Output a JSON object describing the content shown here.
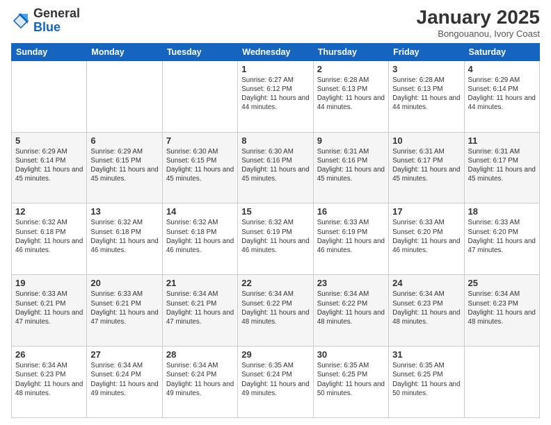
{
  "header": {
    "logo_general": "General",
    "logo_blue": "Blue",
    "month_year": "January 2025",
    "location": "Bongouanou, Ivory Coast"
  },
  "days_of_week": [
    "Sunday",
    "Monday",
    "Tuesday",
    "Wednesday",
    "Thursday",
    "Friday",
    "Saturday"
  ],
  "weeks": [
    [
      {
        "day": "",
        "info": ""
      },
      {
        "day": "",
        "info": ""
      },
      {
        "day": "",
        "info": ""
      },
      {
        "day": "1",
        "info": "Sunrise: 6:27 AM\nSunset: 6:12 PM\nDaylight: 11 hours\nand 44 minutes."
      },
      {
        "day": "2",
        "info": "Sunrise: 6:28 AM\nSunset: 6:13 PM\nDaylight: 11 hours\nand 44 minutes."
      },
      {
        "day": "3",
        "info": "Sunrise: 6:28 AM\nSunset: 6:13 PM\nDaylight: 11 hours\nand 44 minutes."
      },
      {
        "day": "4",
        "info": "Sunrise: 6:29 AM\nSunset: 6:14 PM\nDaylight: 11 hours\nand 44 minutes."
      }
    ],
    [
      {
        "day": "5",
        "info": "Sunrise: 6:29 AM\nSunset: 6:14 PM\nDaylight: 11 hours\nand 45 minutes."
      },
      {
        "day": "6",
        "info": "Sunrise: 6:29 AM\nSunset: 6:15 PM\nDaylight: 11 hours\nand 45 minutes."
      },
      {
        "day": "7",
        "info": "Sunrise: 6:30 AM\nSunset: 6:15 PM\nDaylight: 11 hours\nand 45 minutes."
      },
      {
        "day": "8",
        "info": "Sunrise: 6:30 AM\nSunset: 6:16 PM\nDaylight: 11 hours\nand 45 minutes."
      },
      {
        "day": "9",
        "info": "Sunrise: 6:31 AM\nSunset: 6:16 PM\nDaylight: 11 hours\nand 45 minutes."
      },
      {
        "day": "10",
        "info": "Sunrise: 6:31 AM\nSunset: 6:17 PM\nDaylight: 11 hours\nand 45 minutes."
      },
      {
        "day": "11",
        "info": "Sunrise: 6:31 AM\nSunset: 6:17 PM\nDaylight: 11 hours\nand 45 minutes."
      }
    ],
    [
      {
        "day": "12",
        "info": "Sunrise: 6:32 AM\nSunset: 6:18 PM\nDaylight: 11 hours\nand 46 minutes."
      },
      {
        "day": "13",
        "info": "Sunrise: 6:32 AM\nSunset: 6:18 PM\nDaylight: 11 hours\nand 46 minutes."
      },
      {
        "day": "14",
        "info": "Sunrise: 6:32 AM\nSunset: 6:18 PM\nDaylight: 11 hours\nand 46 minutes."
      },
      {
        "day": "15",
        "info": "Sunrise: 6:32 AM\nSunset: 6:19 PM\nDaylight: 11 hours\nand 46 minutes."
      },
      {
        "day": "16",
        "info": "Sunrise: 6:33 AM\nSunset: 6:19 PM\nDaylight: 11 hours\nand 46 minutes."
      },
      {
        "day": "17",
        "info": "Sunrise: 6:33 AM\nSunset: 6:20 PM\nDaylight: 11 hours\nand 46 minutes."
      },
      {
        "day": "18",
        "info": "Sunrise: 6:33 AM\nSunset: 6:20 PM\nDaylight: 11 hours\nand 47 minutes."
      }
    ],
    [
      {
        "day": "19",
        "info": "Sunrise: 6:33 AM\nSunset: 6:21 PM\nDaylight: 11 hours\nand 47 minutes."
      },
      {
        "day": "20",
        "info": "Sunrise: 6:33 AM\nSunset: 6:21 PM\nDaylight: 11 hours\nand 47 minutes."
      },
      {
        "day": "21",
        "info": "Sunrise: 6:34 AM\nSunset: 6:21 PM\nDaylight: 11 hours\nand 47 minutes."
      },
      {
        "day": "22",
        "info": "Sunrise: 6:34 AM\nSunset: 6:22 PM\nDaylight: 11 hours\nand 48 minutes."
      },
      {
        "day": "23",
        "info": "Sunrise: 6:34 AM\nSunset: 6:22 PM\nDaylight: 11 hours\nand 48 minutes."
      },
      {
        "day": "24",
        "info": "Sunrise: 6:34 AM\nSunset: 6:23 PM\nDaylight: 11 hours\nand 48 minutes."
      },
      {
        "day": "25",
        "info": "Sunrise: 6:34 AM\nSunset: 6:23 PM\nDaylight: 11 hours\nand 48 minutes."
      }
    ],
    [
      {
        "day": "26",
        "info": "Sunrise: 6:34 AM\nSunset: 6:23 PM\nDaylight: 11 hours\nand 48 minutes."
      },
      {
        "day": "27",
        "info": "Sunrise: 6:34 AM\nSunset: 6:24 PM\nDaylight: 11 hours\nand 49 minutes."
      },
      {
        "day": "28",
        "info": "Sunrise: 6:34 AM\nSunset: 6:24 PM\nDaylight: 11 hours\nand 49 minutes."
      },
      {
        "day": "29",
        "info": "Sunrise: 6:35 AM\nSunset: 6:24 PM\nDaylight: 11 hours\nand 49 minutes."
      },
      {
        "day": "30",
        "info": "Sunrise: 6:35 AM\nSunset: 6:25 PM\nDaylight: 11 hours\nand 50 minutes."
      },
      {
        "day": "31",
        "info": "Sunrise: 6:35 AM\nSunset: 6:25 PM\nDaylight: 11 hours\nand 50 minutes."
      },
      {
        "day": "",
        "info": ""
      }
    ]
  ]
}
